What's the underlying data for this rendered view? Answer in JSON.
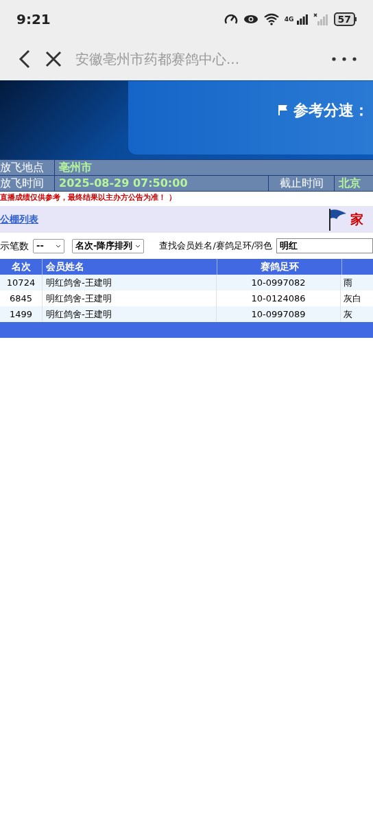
{
  "status_bar": {
    "time": "9:21",
    "network": "4G",
    "battery": "57"
  },
  "browser_bar": {
    "title": "安徽亳州市药都赛鸽中心..."
  },
  "banner": {
    "speed_label": "参考分速："
  },
  "info": {
    "release_place_label": "放飞地点",
    "release_place": "亳州市",
    "release_time_label": "放飞时间",
    "release_time": "2025-08-29 07:50:00",
    "deadline_label": "截止时间",
    "deadline": "北京"
  },
  "notice": "直播成绩仅供参考，最终结果以主办方公告为准！ ）",
  "nav": {
    "link": "公棚列表",
    "title": "家"
  },
  "filters": {
    "count_label": "示笔数",
    "count_value": "--",
    "sort_value": "名次-降序排列",
    "search_label": "查找会员姓名/赛鸽足环/羽色",
    "search_value": "明红"
  },
  "table": {
    "columns": [
      "名次",
      "会员姓名",
      "赛鸽足环"
    ],
    "rows": [
      {
        "rank": "10724",
        "name": "明红鸽舍-王建明",
        "ring": "10-0997082",
        "column_4": "雨"
      },
      {
        "rank": "6845",
        "name": "明红鸽舍-王建明",
        "ring": "10-0124086",
        "column_4": "灰白"
      },
      {
        "rank": "1499",
        "name": "明红鸽舍-王建明",
        "ring": "10-0997089",
        "column_4": "灰"
      }
    ]
  }
}
